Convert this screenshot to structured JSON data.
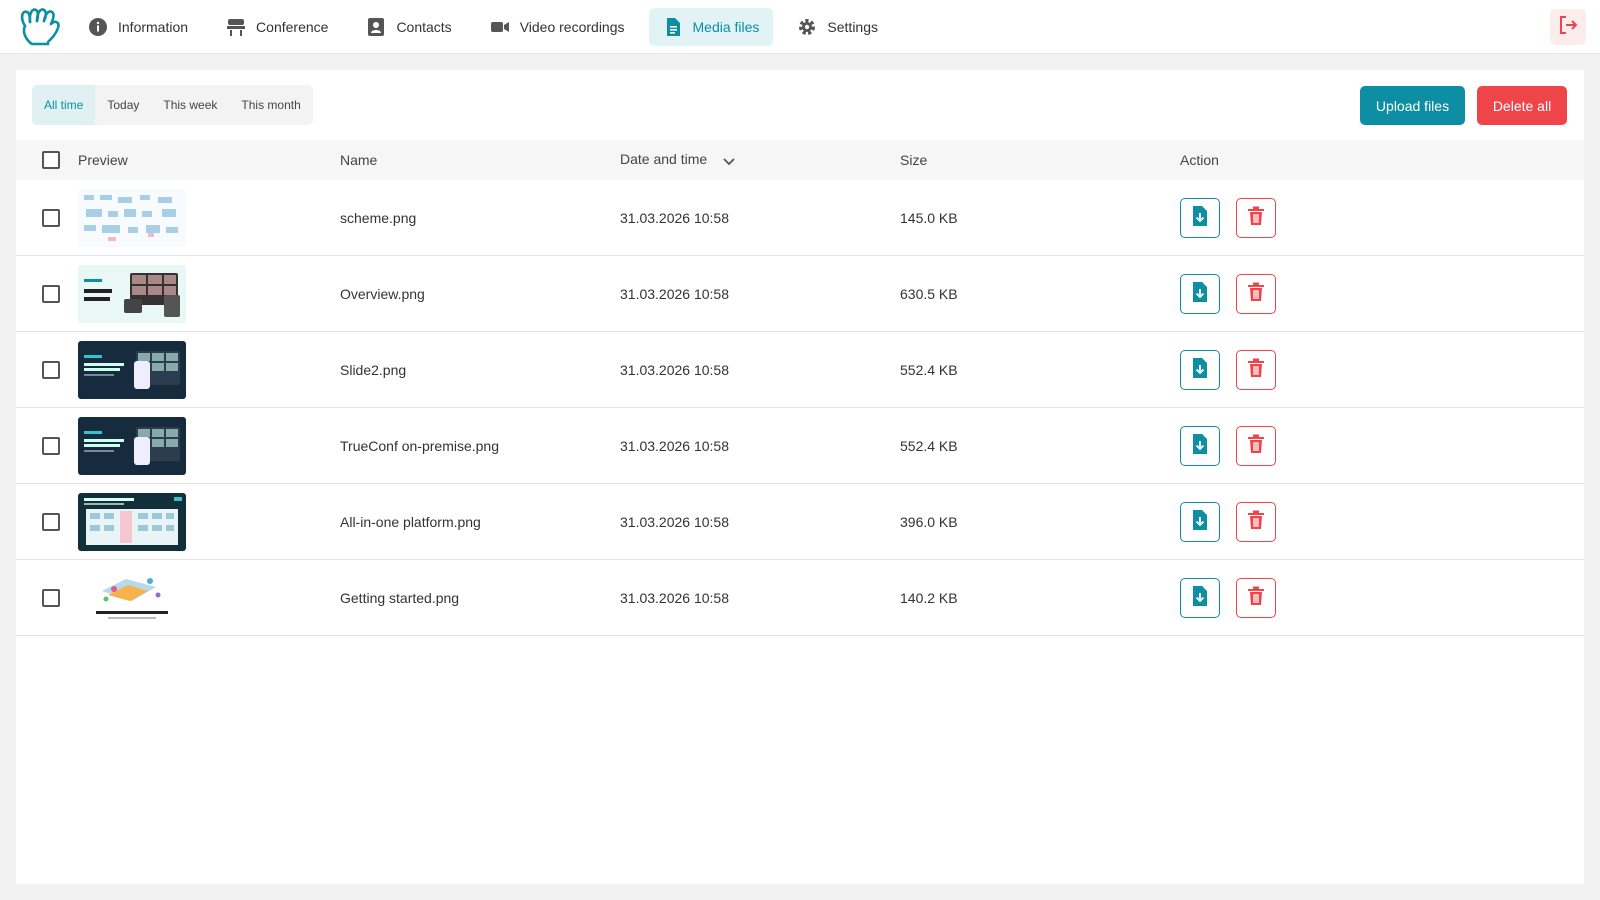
{
  "nav": {
    "items": [
      {
        "label": "Information",
        "icon": "info-icon"
      },
      {
        "label": "Conference",
        "icon": "conference-icon"
      },
      {
        "label": "Contacts",
        "icon": "contacts-icon"
      },
      {
        "label": "Video recordings",
        "icon": "video-icon"
      },
      {
        "label": "Media files",
        "icon": "document-icon",
        "active": true
      },
      {
        "label": "Settings",
        "icon": "gear-icon"
      }
    ]
  },
  "filters": [
    "All time",
    "Today",
    "This week",
    "This month"
  ],
  "active_filter": "All time",
  "toolbar": {
    "upload_label": "Upload files",
    "delete_all_label": "Delete all"
  },
  "table": {
    "headers": {
      "preview": "Preview",
      "name": "Name",
      "date": "Date and time",
      "size": "Size",
      "action": "Action"
    },
    "rows": [
      {
        "name": "scheme.png",
        "date": "31.03.2026 10:58",
        "size": "145.0 KB"
      },
      {
        "name": "Overview.png",
        "date": "31.03.2026 10:58",
        "size": "630.5 KB"
      },
      {
        "name": "Slide2.png",
        "date": "31.03.2026 10:58",
        "size": "552.4 KB"
      },
      {
        "name": "TrueConf on-premise.png",
        "date": "31.03.2026 10:58",
        "size": "552.4 KB"
      },
      {
        "name": "All-in-one platform.png",
        "date": "31.03.2026 10:58",
        "size": "396.0 KB"
      },
      {
        "name": "Getting started.png",
        "date": "31.03.2026 10:58",
        "size": "140.2 KB"
      }
    ]
  },
  "colors": {
    "accent": "#0d8ea3",
    "danger": "#ef4449",
    "active_bg": "#e1f3f5"
  }
}
